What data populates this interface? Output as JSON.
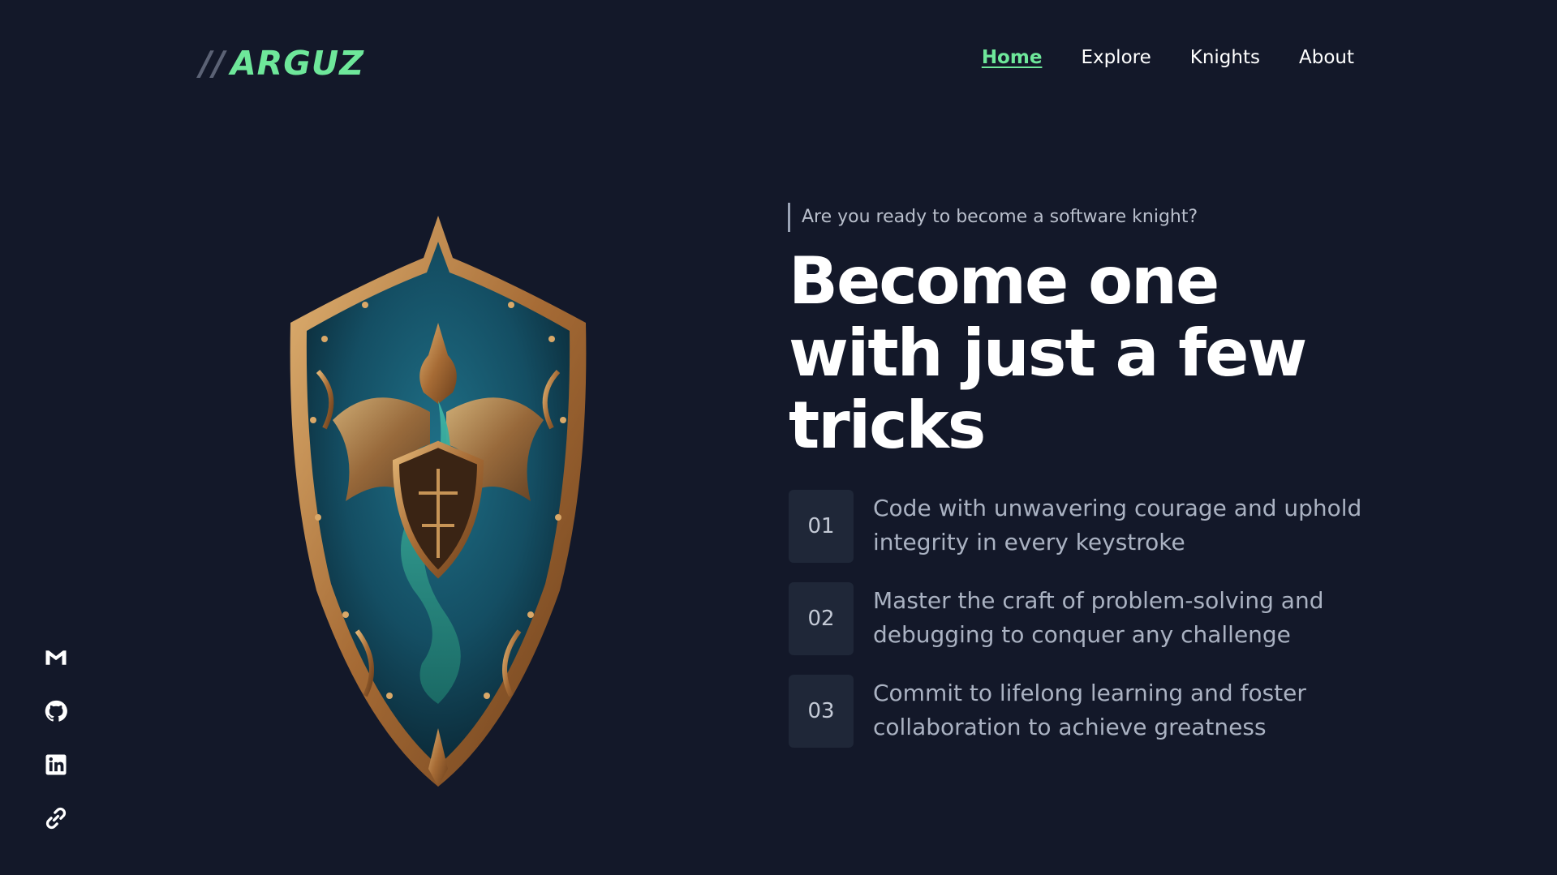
{
  "header": {
    "logo_slashes": "//",
    "logo_name": "ARGUZ",
    "nav": [
      {
        "label": "Home",
        "active": true
      },
      {
        "label": "Explore",
        "active": false
      },
      {
        "label": "Knights",
        "active": false
      },
      {
        "label": "About",
        "active": false
      }
    ]
  },
  "hero": {
    "tagline": "Are you ready to become a software knight?",
    "headline_line1": "Become one",
    "headline_line2": "with just a few",
    "headline_line3": "tricks",
    "points": [
      {
        "number": "01",
        "text_line1": "Code with unwavering courage and uphold",
        "text_line2": "integrity in every keystroke"
      },
      {
        "number": "02",
        "text_line1": "Master the craft of problem-solving and",
        "text_line2": "debugging to conquer any challenge"
      },
      {
        "number": "03",
        "text_line1": "Commit to lifelong learning and foster",
        "text_line2": "collaboration to achieve greatness"
      }
    ]
  },
  "image": {
    "icon": "dragon-shield-image"
  },
  "social": [
    {
      "icon": "gmail-icon"
    },
    {
      "icon": "github-icon"
    },
    {
      "icon": "linkedin-icon"
    },
    {
      "icon": "link-icon"
    }
  ],
  "colors": {
    "background": "#131829",
    "accent": "#6ee79a",
    "number_box": "#1f2738",
    "muted_text": "#aab2c2"
  }
}
